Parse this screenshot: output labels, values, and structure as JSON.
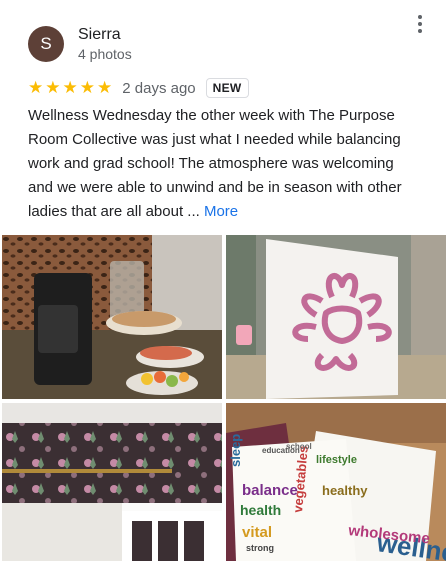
{
  "review": {
    "author": {
      "initial": "S",
      "name": "Sierra",
      "meta": "4 photos",
      "avatar_color": "#5d4037"
    },
    "menu_icon": "more-vert-icon",
    "rating": {
      "stars": 5,
      "icon": "star-icon",
      "color": "#fbbc04"
    },
    "date": "2 days ago",
    "badge": "NEW",
    "text": "Wellness Wednesday the other week with The Purpose Room Collective was just what I needed while balancing work and grad school! The atmosphere was welcoming and we were able to unwind and be in season with other ladies that are all about ...",
    "more_label": "More"
  },
  "photos": [
    {
      "alt": "coffee maker and food platters"
    },
    {
      "alt": "painted flower canvas"
    },
    {
      "alt": "floral wallpaper room"
    },
    {
      "alt": "wellness word cloud cards"
    }
  ],
  "word_cloud": {
    "words": [
      "sleep",
      "balance",
      "health",
      "vital",
      "wellness",
      "vegetables",
      "education",
      "wholesome",
      "school",
      "strong",
      "lifestyle",
      "healthy"
    ]
  }
}
